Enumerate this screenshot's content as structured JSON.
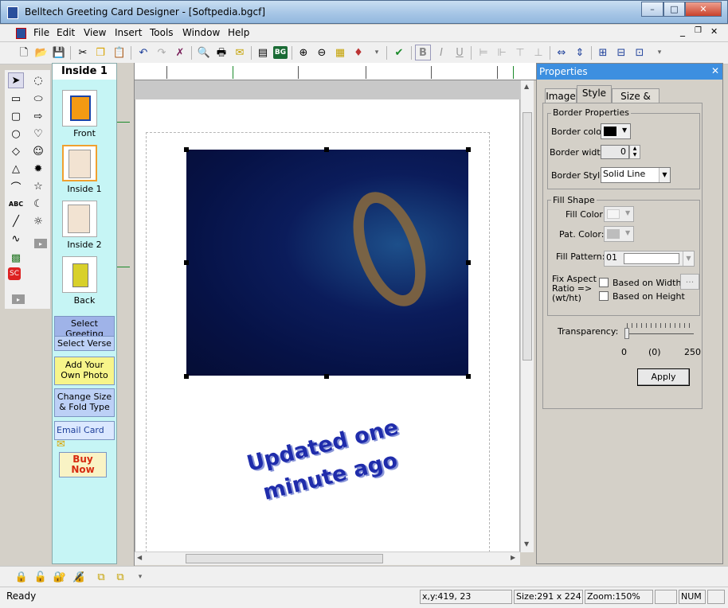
{
  "window": {
    "title": "Belltech Greeting Card Designer  - [Softpedia.bgcf]",
    "min": "–",
    "max": "□",
    "close": "✕"
  },
  "menu": [
    "File",
    "Edit",
    "View",
    "Insert",
    "Tools",
    "Window",
    "Help"
  ],
  "mdi_controls": {
    "min": "_",
    "restore": "❐",
    "close": "✕"
  },
  "pages": {
    "header": "Inside 1",
    "thumbs": [
      {
        "label": "Front"
      },
      {
        "label": "Inside 1"
      },
      {
        "label": "Inside 2"
      },
      {
        "label": "Back"
      }
    ],
    "buttons": {
      "select_greeting": "Select Greeting",
      "select_verse": "Select Verse",
      "add_photo": "Add Your Own Photo",
      "change_size": "Change Size & Fold Type",
      "email_card": "Email Card",
      "buy_now": "Buy Now"
    }
  },
  "canvas": {
    "text": "Updated one minute ago"
  },
  "properties": {
    "title": "Properties",
    "tabs": [
      "Image",
      "Style",
      "Size & Pos"
    ],
    "active_tab": "Style",
    "border": {
      "group": "Border Properties",
      "color_label": "Border color:",
      "width_label": "Border width:",
      "width_value": "0",
      "style_label": "Border Style:",
      "style_value": "Solid Line"
    },
    "fill": {
      "group": "Fill Shape",
      "color_label": "Fill Color:",
      "pat_color_label": "Pat. Color:",
      "pattern_label": "Fill Pattern:",
      "pattern_value": "01",
      "fix_label": "Fix Aspect Ratio => (wt/ht)",
      "on_width": "Based on Width",
      "on_height": "Based on Height",
      "ellipsis": "..."
    },
    "transparency": {
      "label": "Transparency:",
      "min": "0",
      "value": "(0)",
      "max": "250"
    },
    "apply": "Apply"
  },
  "status": {
    "ready": "Ready",
    "xy": "x,y:419, 23",
    "size": "Size:291 x 224",
    "zoom": "Zoom:150%",
    "num": "NUM"
  }
}
